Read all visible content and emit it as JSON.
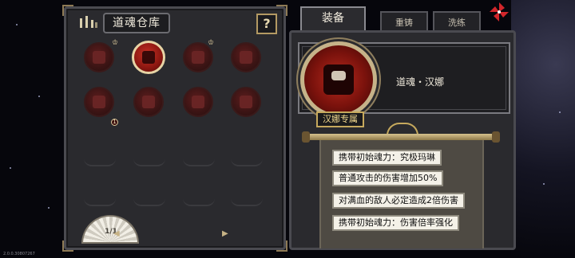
{
  "left_panel": {
    "title": "道魂仓库",
    "help_label": "?",
    "page_indicator": "1/1"
  },
  "orbs": [
    {
      "state": "normal",
      "mark": "♔"
    },
    {
      "state": "selected",
      "mark": ""
    },
    {
      "state": "normal",
      "mark": "♔"
    },
    {
      "state": "normal",
      "mark": ""
    },
    {
      "state": "normal",
      "mark": "",
      "badge": "1"
    },
    {
      "state": "normal",
      "mark": ""
    },
    {
      "state": "normal",
      "mark": ""
    },
    {
      "state": "normal",
      "mark": ""
    }
  ],
  "tabs": {
    "equip": "装备",
    "forge": "重铸",
    "refine": "洗练"
  },
  "detail": {
    "soul_name": "道魂・汉娜",
    "weapon_tag": "汉娜专属"
  },
  "effects": [
    "携带初始魂力：究极玛琳",
    "普通攻击的伤害增加50%",
    "对满血的敌人必定造成2倍伤害",
    "携带初始魂力：伤害倍率强化"
  ],
  "footer": {
    "version": "2.0.0.30807267"
  },
  "colors": {
    "accent_gold": "#c6a95d",
    "orb_red": "#b72a1e",
    "panel_bg": "#2a2a2e"
  }
}
